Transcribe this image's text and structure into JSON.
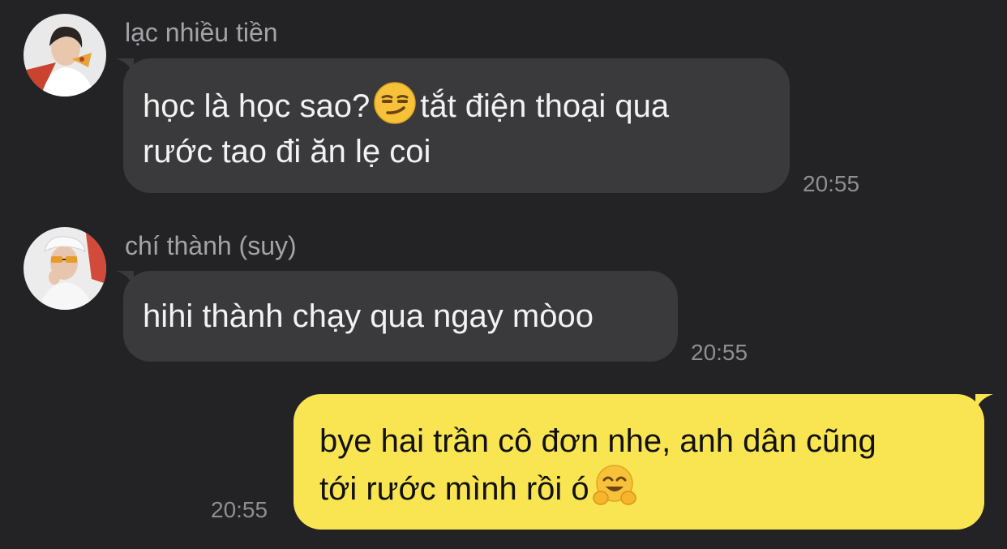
{
  "messages": [
    {
      "sender": "lạc nhiều tiền",
      "line1_before_emoji": "học là học sao?",
      "emoji": "smirk-emoji",
      "line1_after_emoji": "tắt điện thoại qua",
      "line2": "rước tao đi ăn lẹ coi",
      "time": "20:55"
    },
    {
      "sender": "chí thành (suy)",
      "line1": "hihi thành chạy qua ngay mòoo",
      "time": "20:55"
    },
    {
      "line1": "bye hai trần cô đơn nhe, anh dân cũng",
      "line2_before_emoji": "tới rước mình rồi ó",
      "emoji": "hugging-emoji",
      "time": "20:55"
    }
  ],
  "colors": {
    "background": "#232325",
    "incoming_bubble": "#3a3a3c",
    "outgoing_bubble": "#f9e552",
    "sender_text": "#a3a3a8",
    "time_text": "#8e8e93"
  }
}
